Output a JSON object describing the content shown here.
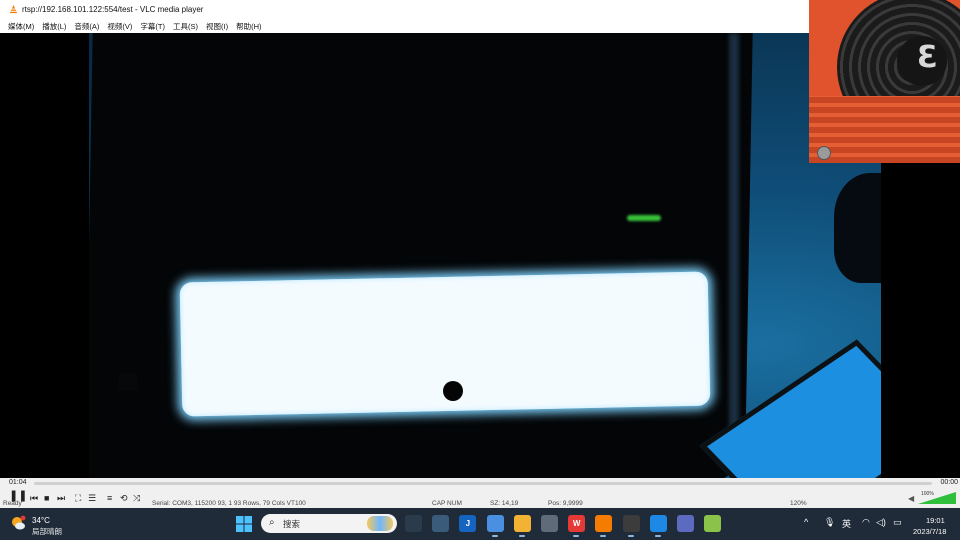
{
  "window": {
    "title": "rtsp://192.168.101.122:554/test - VLC media player",
    "menu": [
      "媒体(M)",
      "播放(L)",
      "音频(A)",
      "视频(V)",
      "字幕(T)",
      "工具(S)",
      "视图(I)",
      "帮助(H)"
    ]
  },
  "player": {
    "time_current": "01:04",
    "time_total": "00:00",
    "volume_percent": "100%",
    "volume_level": 1.0,
    "controls": [
      "pause",
      "previous",
      "stop",
      "next",
      "fullscreen",
      "extended-settings",
      "playlist",
      "loop",
      "shuffle"
    ]
  },
  "background_app": {
    "status_left": "Ready",
    "status_text": "Serial: COM3, 115200    93,  1    93 Rows, 79 Cols    VT100",
    "status_caps": "CAP NUM",
    "status_size": "SZ: 14,19",
    "status_pos": "Pos: 9,9999",
    "status_zoom": "120%"
  },
  "taskbar": {
    "weather": {
      "temp": "34°C",
      "desc": "局部晴朗"
    },
    "search_placeholder": "搜索",
    "apps": [
      {
        "name": "task-view",
        "color": "#2a3b4c",
        "label": ""
      },
      {
        "name": "weather-widget",
        "color": "#3a5b7a",
        "label": ""
      },
      {
        "name": "jflash",
        "color": "#1565c0",
        "label": "J"
      },
      {
        "name": "browser",
        "color": "#4a90e2",
        "label": ""
      },
      {
        "name": "file-explorer",
        "color": "#f2b233",
        "label": ""
      },
      {
        "name": "notepad",
        "color": "#5f6b78",
        "label": ""
      },
      {
        "name": "wps",
        "color": "#e53935",
        "label": "W"
      },
      {
        "name": "vlc",
        "color": "#f57c00",
        "label": ""
      },
      {
        "name": "obs",
        "color": "#3c3c3c",
        "label": ""
      },
      {
        "name": "edge",
        "color": "#1e88e5",
        "label": ""
      },
      {
        "name": "remote-tool",
        "color": "#5c6bc0",
        "label": ""
      },
      {
        "name": "app-cube",
        "color": "#8bc34a",
        "label": ""
      }
    ],
    "tray": {
      "ime": "英"
    },
    "clock": {
      "time": "19:01",
      "date": "2023/7/18"
    }
  }
}
